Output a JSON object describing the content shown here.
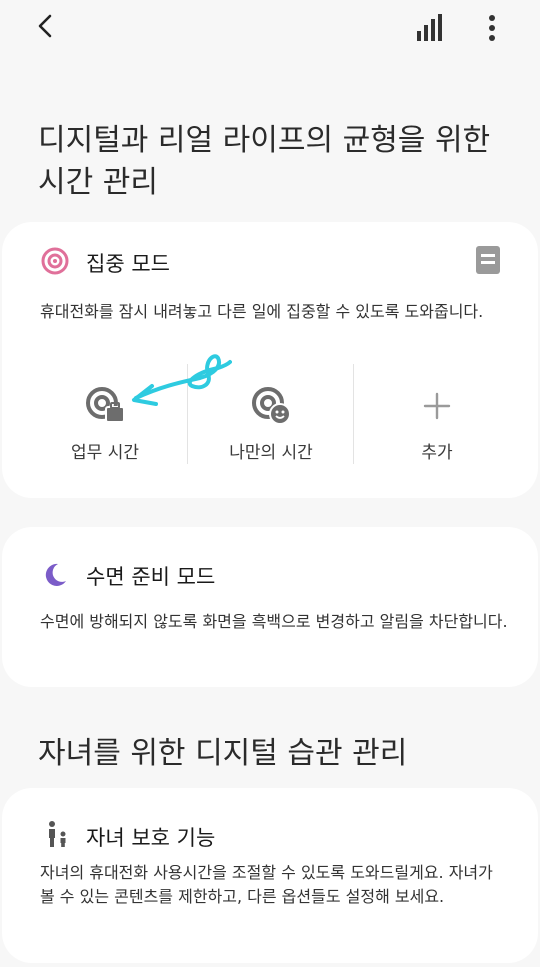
{
  "header": {
    "back_icon": "back-arrow-icon",
    "stats_icon": "bar-chart-icon",
    "more_icon": "more-vert-icon"
  },
  "headline": "디지털과 리얼 라이프의 균형을 위한 시간 관리",
  "focus_card": {
    "title": "집중 모드",
    "description": "휴대전화를 잠시 내려놓고 다른 일에 집중할 수 있도록 도와줍니다.",
    "modes": [
      {
        "label": "업무 시간",
        "icon": "focus-work-icon"
      },
      {
        "label": "나만의 시간",
        "icon": "focus-personal-icon"
      },
      {
        "label": "추가",
        "icon": "plus-icon"
      }
    ],
    "colors": {
      "focus": "#e0709a",
      "scribble": "#2ecbe0"
    }
  },
  "bedtime_card": {
    "title": "수면 준비 모드",
    "description": "수면에 방해되지 않도록 화면을 흑백으로 변경하고 알림을 차단합니다.",
    "colors": {
      "moon": "#7b5cc8"
    }
  },
  "section_title": "자녀를 위한 디지털 습관 관리",
  "parental_card": {
    "title": "자녀 보호 기능",
    "description": "자녀의 휴대전화 사용시간을 조절할 수 있도록 도와드릴게요. 자녀가 볼 수 있는 콘텐츠를 제한하고, 다른 옵션들도 설정해 보세요."
  }
}
